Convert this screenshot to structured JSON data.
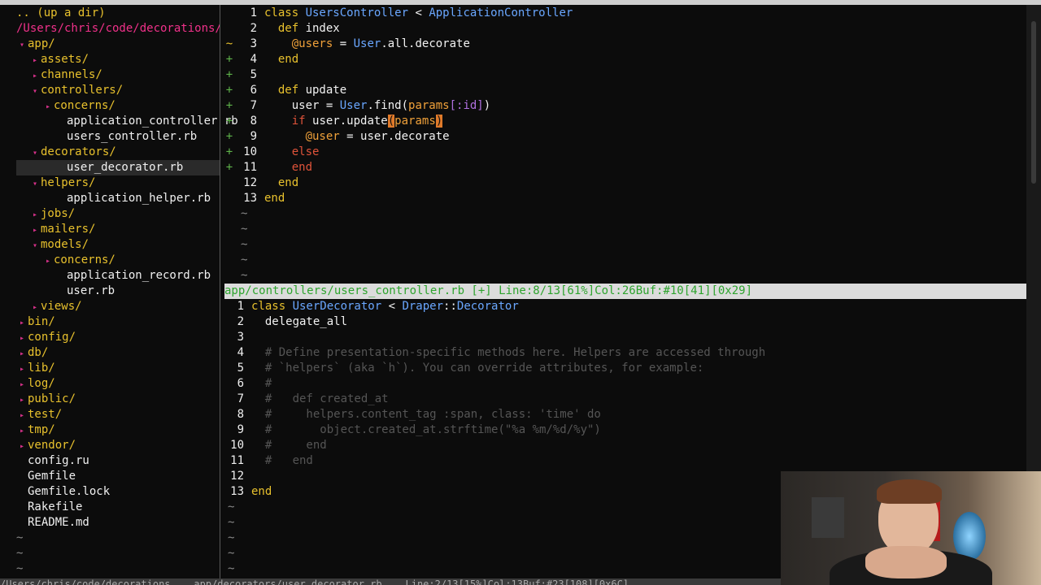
{
  "tree": {
    "updir": ".. (up a dir)",
    "root": "/Users/chris/code/decorations/",
    "items": [
      {
        "label": "app/",
        "type": "dir",
        "indent": 1,
        "arrow": "open"
      },
      {
        "label": "assets/",
        "type": "dir",
        "indent": 2,
        "arrow": "closed"
      },
      {
        "label": "channels/",
        "type": "dir",
        "indent": 2,
        "arrow": "closed"
      },
      {
        "label": "controllers/",
        "type": "dir",
        "indent": 2,
        "arrow": "open"
      },
      {
        "label": "concerns/",
        "type": "dir",
        "indent": 3,
        "arrow": "closed"
      },
      {
        "label": "application_controller.rb",
        "type": "file",
        "indent": 4
      },
      {
        "label": "users_controller.rb",
        "type": "file",
        "indent": 4
      },
      {
        "label": "decorators/",
        "type": "dir",
        "indent": 2,
        "arrow": "open"
      },
      {
        "label": "user_decorator.rb",
        "type": "file",
        "indent": 4,
        "selected": true
      },
      {
        "label": "helpers/",
        "type": "dir",
        "indent": 2,
        "arrow": "open"
      },
      {
        "label": "application_helper.rb",
        "type": "file",
        "indent": 4
      },
      {
        "label": "jobs/",
        "type": "dir",
        "indent": 2,
        "arrow": "closed"
      },
      {
        "label": "mailers/",
        "type": "dir",
        "indent": 2,
        "arrow": "closed"
      },
      {
        "label": "models/",
        "type": "dir",
        "indent": 2,
        "arrow": "open"
      },
      {
        "label": "concerns/",
        "type": "dir",
        "indent": 3,
        "arrow": "closed"
      },
      {
        "label": "application_record.rb",
        "type": "file",
        "indent": 4
      },
      {
        "label": "user.rb",
        "type": "file",
        "indent": 4
      },
      {
        "label": "views/",
        "type": "dir",
        "indent": 2,
        "arrow": "closed"
      },
      {
        "label": "bin/",
        "type": "dir",
        "indent": 1,
        "arrow": "closed"
      },
      {
        "label": "config/",
        "type": "dir",
        "indent": 1,
        "arrow": "closed"
      },
      {
        "label": "db/",
        "type": "dir",
        "indent": 1,
        "arrow": "closed"
      },
      {
        "label": "lib/",
        "type": "dir",
        "indent": 1,
        "arrow": "closed"
      },
      {
        "label": "log/",
        "type": "dir",
        "indent": 1,
        "arrow": "closed"
      },
      {
        "label": "public/",
        "type": "dir",
        "indent": 1,
        "arrow": "closed"
      },
      {
        "label": "test/",
        "type": "dir",
        "indent": 1,
        "arrow": "closed"
      },
      {
        "label": "tmp/",
        "type": "dir",
        "indent": 1,
        "arrow": "closed"
      },
      {
        "label": "vendor/",
        "type": "dir",
        "indent": 1,
        "arrow": "closed"
      },
      {
        "label": "config.ru",
        "type": "file",
        "indent": 1
      },
      {
        "label": "Gemfile",
        "type": "file",
        "indent": 1
      },
      {
        "label": "Gemfile.lock",
        "type": "file",
        "indent": 1
      },
      {
        "label": "Rakefile",
        "type": "file",
        "indent": 1
      },
      {
        "label": "README.md",
        "type": "file",
        "indent": 1
      }
    ],
    "tail": [
      "~",
      "~",
      "~"
    ]
  },
  "top_pane": {
    "lines": [
      {
        "n": "1",
        "sign": "",
        "tokens": [
          [
            "kw",
            "class "
          ],
          [
            "cls",
            "UsersController"
          ],
          [
            "plain",
            " < "
          ],
          [
            "cls",
            "ApplicationController"
          ]
        ]
      },
      {
        "n": "2",
        "sign": "",
        "tokens": [
          [
            "kw",
            "  def "
          ],
          [
            "plain",
            "index"
          ]
        ]
      },
      {
        "n": "3",
        "sign": "~",
        "tokens": [
          [
            "plain",
            "    "
          ],
          [
            "ivar",
            "@users"
          ],
          [
            "plain",
            " = "
          ],
          [
            "cls",
            "User"
          ],
          [
            "plain",
            ".all.decorate"
          ]
        ]
      },
      {
        "n": "4",
        "sign": "+",
        "tokens": [
          [
            "kw",
            "  end"
          ]
        ]
      },
      {
        "n": "5",
        "sign": "+",
        "tokens": []
      },
      {
        "n": "6",
        "sign": "+",
        "tokens": [
          [
            "kw",
            "  def "
          ],
          [
            "plain",
            "update"
          ]
        ]
      },
      {
        "n": "7",
        "sign": "+",
        "tokens": [
          [
            "plain",
            "    user = "
          ],
          [
            "cls",
            "User"
          ],
          [
            "plain",
            ".find("
          ],
          [
            "ivar",
            "params"
          ],
          [
            "sym",
            "[:id]"
          ],
          [
            "plain",
            ")"
          ]
        ]
      },
      {
        "n": "8",
        "sign": "+",
        "tokens": [
          [
            "red",
            "    if "
          ],
          [
            "plain",
            "user.update"
          ],
          [
            "hl",
            "("
          ],
          [
            "ivar",
            "params"
          ],
          [
            "hl",
            ")"
          ]
        ]
      },
      {
        "n": "9",
        "sign": "+",
        "tokens": [
          [
            "plain",
            "      "
          ],
          [
            "ivar",
            "@user"
          ],
          [
            "plain",
            " = user.decorate"
          ]
        ]
      },
      {
        "n": "10",
        "sign": "+",
        "tokens": [
          [
            "red",
            "    else"
          ]
        ]
      },
      {
        "n": "11",
        "sign": "+",
        "tokens": [
          [
            "red",
            "    end"
          ]
        ]
      },
      {
        "n": "12",
        "sign": "",
        "tokens": [
          [
            "kw",
            "  end"
          ]
        ]
      },
      {
        "n": "13",
        "sign": "",
        "tokens": [
          [
            "kw",
            "end"
          ]
        ]
      }
    ],
    "tildes": [
      "~",
      "~",
      "~",
      "~",
      "~"
    ]
  },
  "status_mid": "app/controllers/users_controller.rb [+] Line:8/13[61%]Col:26Buf:#10[41][0x29]",
  "bottom_pane": {
    "lines": [
      {
        "n": "1",
        "tokens": [
          [
            "kw",
            "class "
          ],
          [
            "cls",
            "UserDecorator"
          ],
          [
            "plain",
            " < "
          ],
          [
            "cls",
            "Draper"
          ],
          [
            "plain",
            "::"
          ],
          [
            "cls",
            "Decorator"
          ]
        ]
      },
      {
        "n": "2",
        "tokens": [
          [
            "plain",
            "  delegate_all"
          ]
        ]
      },
      {
        "n": "3",
        "tokens": []
      },
      {
        "n": "4",
        "tokens": [
          [
            "cmt",
            "  # Define presentation-specific methods here. Helpers are accessed through"
          ]
        ]
      },
      {
        "n": "5",
        "tokens": [
          [
            "cmt",
            "  # `helpers` (aka `h`). You can override attributes, for example:"
          ]
        ]
      },
      {
        "n": "6",
        "tokens": [
          [
            "cmt",
            "  #"
          ]
        ]
      },
      {
        "n": "7",
        "tokens": [
          [
            "cmt",
            "  #   def created_at"
          ]
        ]
      },
      {
        "n": "8",
        "tokens": [
          [
            "cmt",
            "  #     helpers.content_tag :span, class: 'time' do"
          ]
        ]
      },
      {
        "n": "9",
        "tokens": [
          [
            "cmt",
            "  #       object.created_at.strftime(\"%a %m/%d/%y\")"
          ]
        ]
      },
      {
        "n": "10",
        "tokens": [
          [
            "cmt",
            "  #     end"
          ]
        ]
      },
      {
        "n": "11",
        "tokens": [
          [
            "cmt",
            "  #   end"
          ]
        ]
      },
      {
        "n": "12",
        "tokens": []
      },
      {
        "n": "13",
        "tokens": [
          [
            "kw",
            "end"
          ]
        ]
      }
    ],
    "tildes": [
      "~",
      "~",
      "~",
      "~",
      "~"
    ]
  },
  "status_bottom": "/Users/chris/code/decorations    app/decorators/user_decorator.rb    Line:2/13[15%]Col:13Buf:#23[108][0x6C]"
}
